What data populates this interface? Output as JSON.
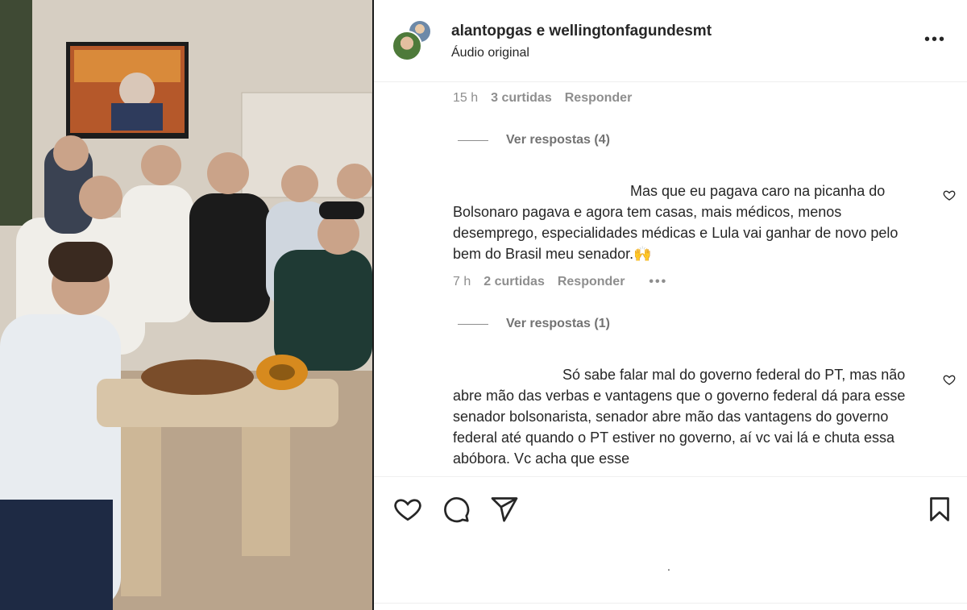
{
  "post": {
    "authors": "alantopgas e wellingtonfagundesmt",
    "audio": "Áudio original",
    "more_icon": "more-horizontal-icon",
    "more_glyph": "•••"
  },
  "comments": [
    {
      "time": "15 h",
      "likes": "3 curtidas",
      "reply_label": "Responder",
      "view_replies": "Ver respostas (4)"
    },
    {
      "text": "Mas que eu pagava caro na picanha do Bolsonaro pagava e agora tem casas, mais médicos, menos desemprego, especialidades médicas e Lula vai ganhar de novo pelo bem do Brasil meu senador.🙌",
      "time": "7 h",
      "likes": "2 curtidas",
      "reply_label": "Responder",
      "options_glyph": "•••",
      "view_replies": "Ver respostas (1)"
    },
    {
      "text": "Só sabe falar mal do governo federal do PT, mas não abre mão das verbas e vantagens que o governo federal dá para esse senador bolsonarista, senador abre mão das vantagens do governo federal até quando o PT estiver no governo, aí vc vai lá e chuta essa abóbora. Vc acha que esse"
    }
  ],
  "actions": {
    "like_icon": "heart-icon",
    "comment_icon": "comment-bubble-icon",
    "share_icon": "paper-plane-icon",
    "save_icon": "bookmark-icon",
    "loading_glyph": "."
  },
  "colors": {
    "text_primary": "#262626",
    "text_secondary": "#8e8e8e",
    "border": "#efefef",
    "divider": "#1a1a1a"
  }
}
